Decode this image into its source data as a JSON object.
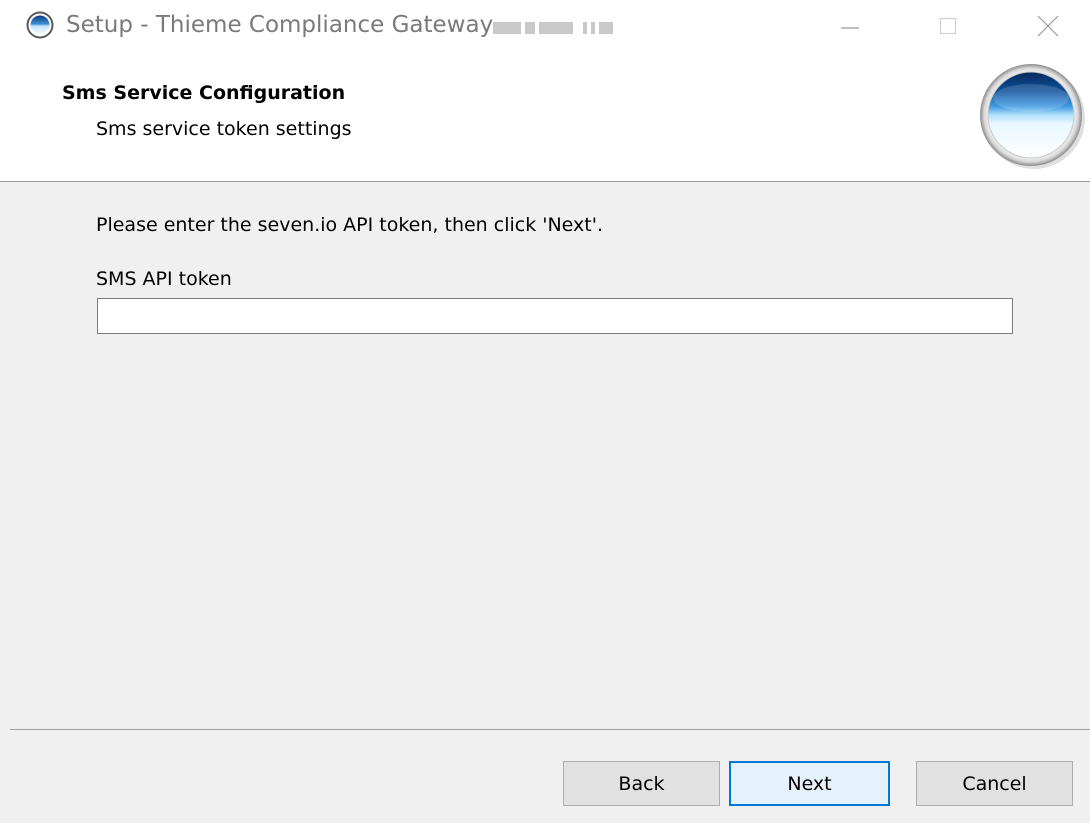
{
  "window": {
    "title": "Setup - Thieme Compliance Gateway",
    "controls": {
      "minimize_icon": "minimize-icon",
      "maximize_icon": "maximize-icon",
      "close_icon": "close-icon"
    }
  },
  "header": {
    "title": "Sms Service Configuration",
    "subtitle": "Sms service token settings"
  },
  "body": {
    "instruction": "Please enter the seven.io API token, then click 'Next'.",
    "token_label": "SMS API token",
    "token_value": ""
  },
  "buttons": {
    "back": "Back",
    "next": "Next",
    "cancel": "Cancel"
  },
  "colors": {
    "window_bg": "#f0f0f0",
    "header_bg": "#ffffff",
    "focus_border": "#0078d7",
    "button_bg": "#e1e1e1"
  }
}
